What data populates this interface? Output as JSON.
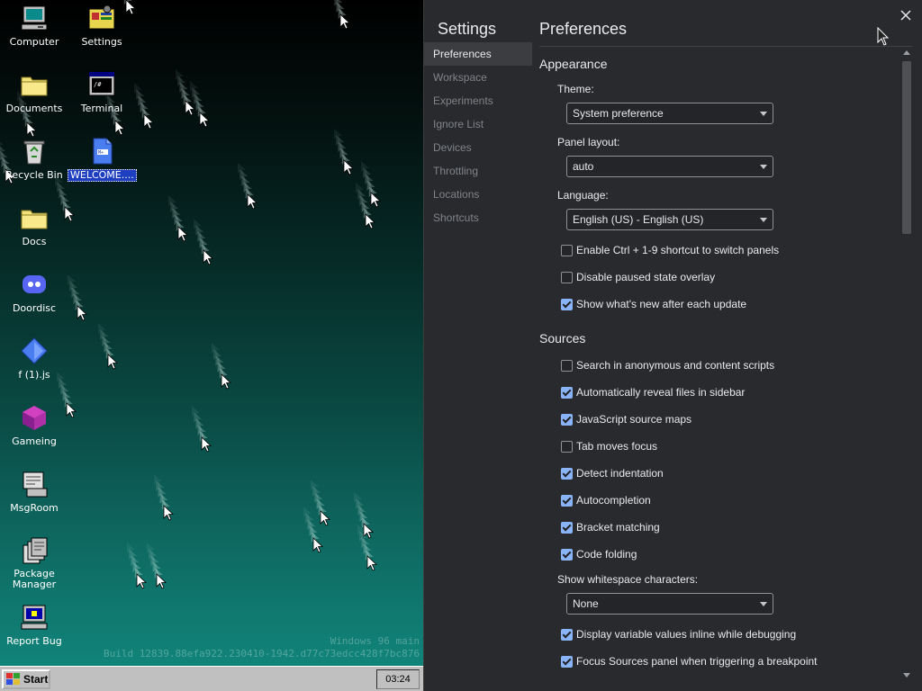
{
  "desktop": {
    "icons": [
      {
        "label": "Computer",
        "icon": "computer-icon"
      },
      {
        "label": "Settings",
        "icon": "settings-icon"
      },
      {
        "label": "Documents",
        "icon": "folder-icon"
      },
      {
        "label": "Terminal",
        "icon": "terminal-icon"
      },
      {
        "label": "Recycle Bin",
        "icon": "recycle-bin-icon"
      },
      {
        "label": "WELCOME....",
        "icon": "document-icon"
      },
      {
        "label": "Docs",
        "icon": "folder-icon"
      },
      {
        "label": "Doordisc",
        "icon": "doordisc-icon"
      },
      {
        "label": "f (1).js",
        "icon": "js-file-icon"
      },
      {
        "label": "Gameing",
        "icon": "cube-icon"
      },
      {
        "label": "MsgRoom",
        "icon": "msgroom-icon"
      },
      {
        "label": "Package Manager",
        "icon": "package-manager-icon"
      },
      {
        "label": "Report Bug",
        "icon": "report-bug-icon"
      }
    ],
    "watermark_line1": "Windows 96 main",
    "watermark_line2": "Build 12839.88efa922.230410-1942.d77c73edcc428f7bc876"
  },
  "taskbar": {
    "start_label": "Start",
    "clock": "03:24"
  },
  "settings": {
    "title": "Settings",
    "close_icon": "close-icon",
    "nav": [
      "Preferences",
      "Workspace",
      "Experiments",
      "Ignore List",
      "Devices",
      "Throttling",
      "Locations",
      "Shortcuts"
    ],
    "active_nav": "Preferences",
    "content_title": "Preferences",
    "appearance": {
      "heading": "Appearance",
      "theme_label": "Theme:",
      "theme_value": "System preference",
      "panel_layout_label": "Panel layout:",
      "panel_layout_value": "auto",
      "language_label": "Language:",
      "language_value": "English (US) - English (US)",
      "checkboxes": [
        {
          "label": "Enable Ctrl + 1-9 shortcut to switch panels",
          "checked": false
        },
        {
          "label": "Disable paused state overlay",
          "checked": false
        },
        {
          "label": "Show what's new after each update",
          "checked": true
        }
      ]
    },
    "sources": {
      "heading": "Sources",
      "checkboxes": [
        {
          "label": "Search in anonymous and content scripts",
          "checked": false
        },
        {
          "label": "Automatically reveal files in sidebar",
          "checked": true
        },
        {
          "label": "JavaScript source maps",
          "checked": true
        },
        {
          "label": "Tab moves focus",
          "checked": false
        },
        {
          "label": "Detect indentation",
          "checked": true
        },
        {
          "label": "Autocompletion",
          "checked": true
        },
        {
          "label": "Bracket matching",
          "checked": true
        },
        {
          "label": "Code folding",
          "checked": true
        }
      ],
      "whitespace_label": "Show whitespace characters:",
      "whitespace_value": "None",
      "checkboxes_after": [
        {
          "label": "Display variable values inline while debugging",
          "checked": true
        },
        {
          "label": "Focus Sources panel when triggering a breakpoint",
          "checked": true
        }
      ]
    }
  }
}
